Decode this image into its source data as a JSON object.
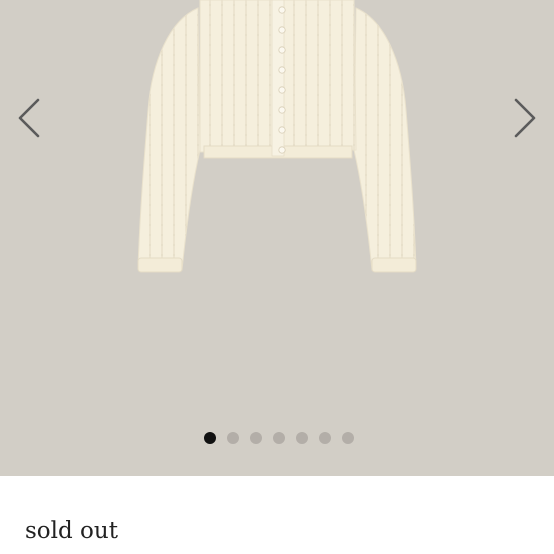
{
  "gallery": {
    "background_color": "#d2cec6",
    "product_image": "cream-cropped-knit-cardigan",
    "prev_icon": "chevron-left-icon",
    "next_icon": "chevron-right-icon",
    "image_count": 7,
    "active_index": 0
  },
  "status": {
    "label": "sold out"
  }
}
